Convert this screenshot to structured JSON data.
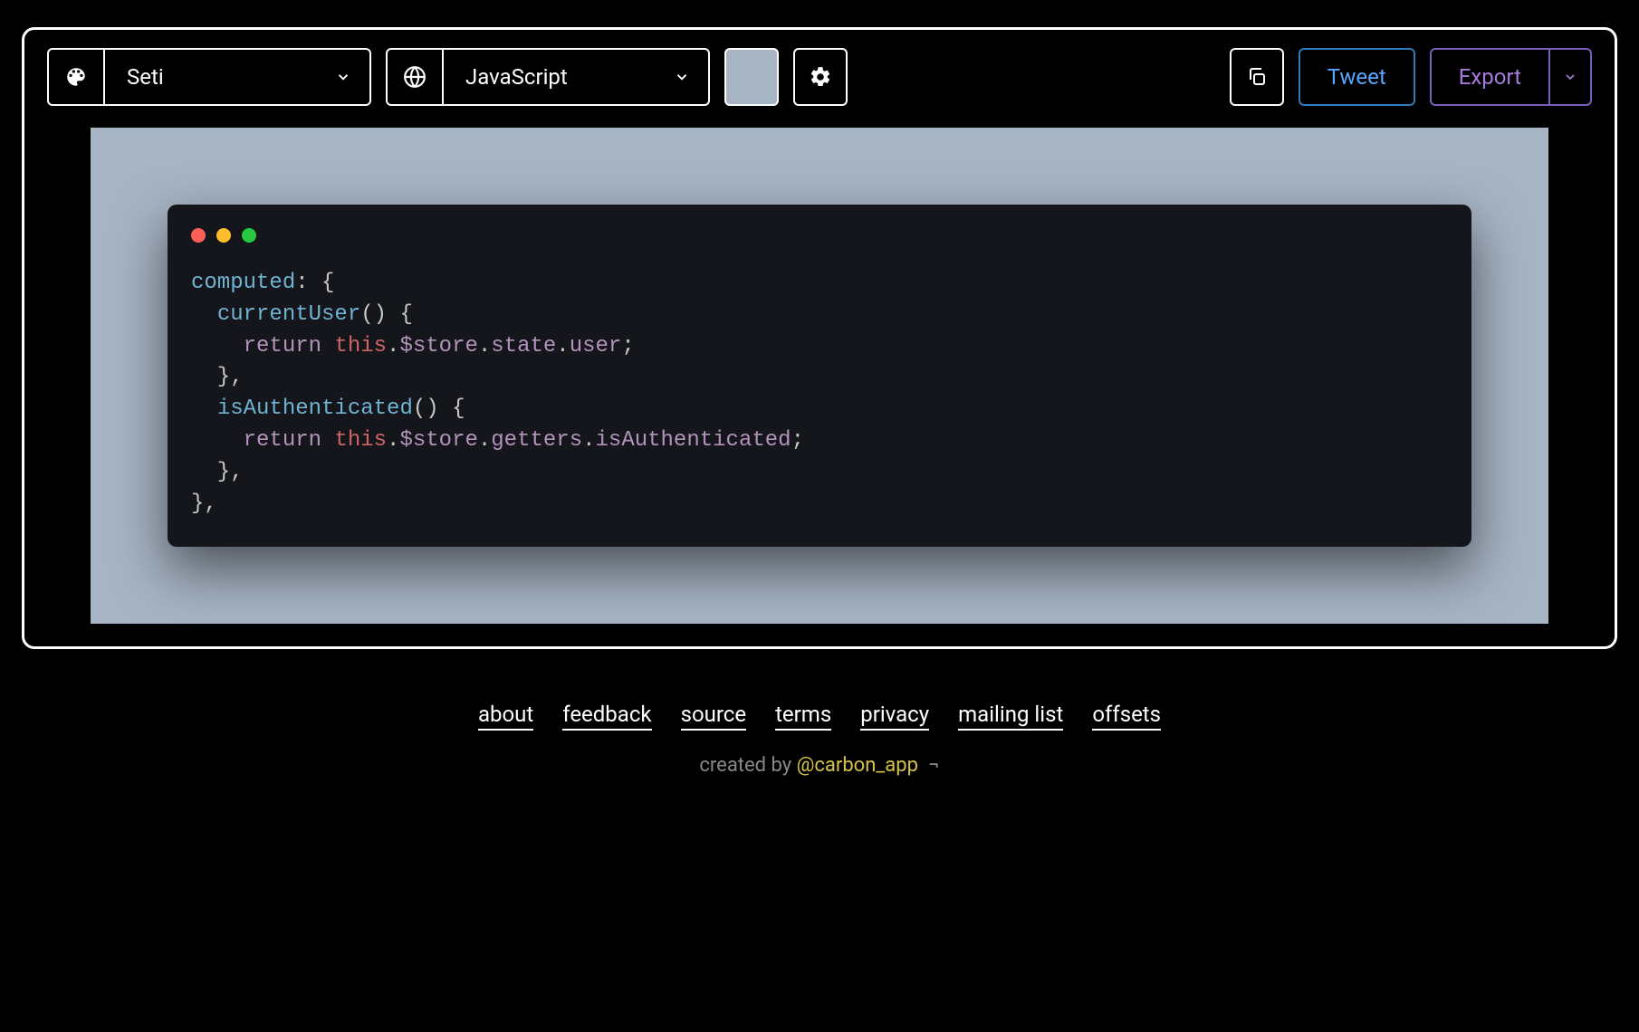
{
  "toolbar": {
    "theme_label": "Seti",
    "language_label": "JavaScript",
    "bg_color": "#a7b4c4",
    "tweet_label": "Tweet",
    "export_label": "Export"
  },
  "code": {
    "tokens": [
      [
        {
          "t": "computed",
          "c": "tok-prop"
        },
        {
          "t": ": {",
          "c": "tok-punc"
        }
      ],
      [
        {
          "t": "  ",
          "c": ""
        },
        {
          "t": "currentUser",
          "c": "tok-method"
        },
        {
          "t": "() {",
          "c": "tok-punc"
        }
      ],
      [
        {
          "t": "    ",
          "c": ""
        },
        {
          "t": "return",
          "c": "tok-kw"
        },
        {
          "t": " ",
          "c": ""
        },
        {
          "t": "this",
          "c": "tok-this"
        },
        {
          "t": ".",
          "c": "tok-dot"
        },
        {
          "t": "$store",
          "c": "tok-attr"
        },
        {
          "t": ".",
          "c": "tok-dot"
        },
        {
          "t": "state",
          "c": "tok-attr"
        },
        {
          "t": ".",
          "c": "tok-dot"
        },
        {
          "t": "user",
          "c": "tok-attr"
        },
        {
          "t": ";",
          "c": "tok-punc"
        }
      ],
      [
        {
          "t": "  },",
          "c": "tok-punc"
        }
      ],
      [
        {
          "t": "  ",
          "c": ""
        },
        {
          "t": "isAuthenticated",
          "c": "tok-method"
        },
        {
          "t": "() {",
          "c": "tok-punc"
        }
      ],
      [
        {
          "t": "    ",
          "c": ""
        },
        {
          "t": "return",
          "c": "tok-kw"
        },
        {
          "t": " ",
          "c": ""
        },
        {
          "t": "this",
          "c": "tok-this"
        },
        {
          "t": ".",
          "c": "tok-dot"
        },
        {
          "t": "$store",
          "c": "tok-attr"
        },
        {
          "t": ".",
          "c": "tok-dot"
        },
        {
          "t": "getters",
          "c": "tok-attr"
        },
        {
          "t": ".",
          "c": "tok-dot"
        },
        {
          "t": "isAuthenticated",
          "c": "tok-attr"
        },
        {
          "t": ";",
          "c": "tok-punc"
        }
      ],
      [
        {
          "t": "  },",
          "c": "tok-punc"
        }
      ],
      [
        {
          "t": "},",
          "c": "tok-punc"
        }
      ]
    ]
  },
  "footer": {
    "links": [
      "about",
      "feedback",
      "source",
      "terms",
      "privacy",
      "mailing list",
      "offsets"
    ],
    "created_prefix": "created by ",
    "created_handle": "@carbon_app",
    "created_suffix": " ¬"
  }
}
